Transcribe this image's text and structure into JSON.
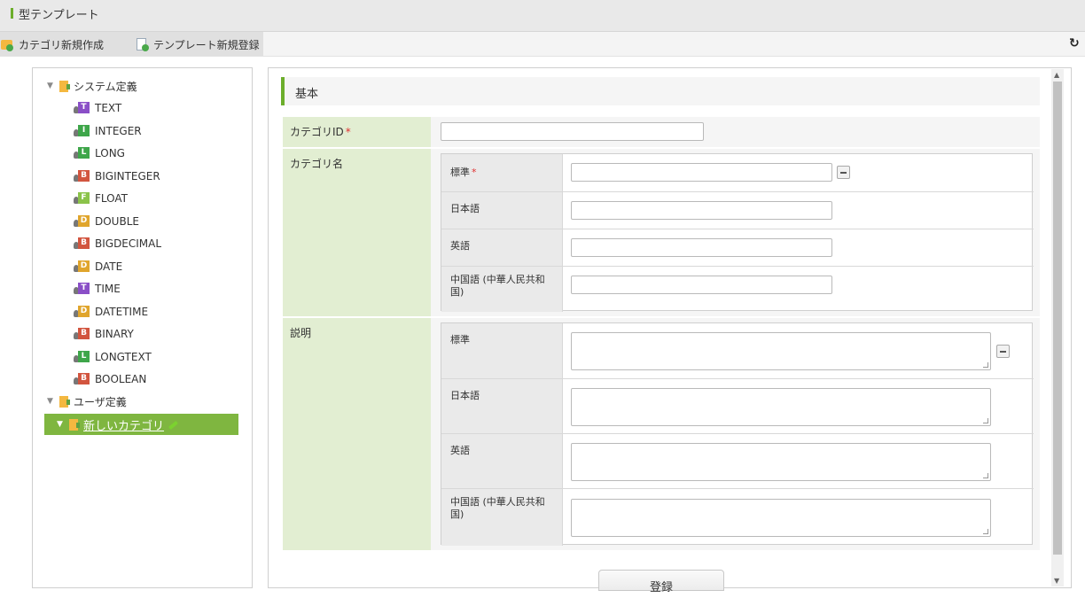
{
  "window": {
    "title": "型テンプレート"
  },
  "toolbar": {
    "new_category_label": "カテゴリ新規作成",
    "new_template_label": "テンプレート新規登録",
    "refresh_icon": "refresh-icon"
  },
  "tree": {
    "system_root": "システム定義",
    "types": [
      {
        "label": "TEXT",
        "badge": "T",
        "color": "#8a4fc7"
      },
      {
        "label": "INTEGER",
        "badge": "I",
        "color": "#3ea64a"
      },
      {
        "label": "LONG",
        "badge": "L",
        "color": "#3ea64a"
      },
      {
        "label": "BIGINTEGER",
        "badge": "B",
        "color": "#d2553f"
      },
      {
        "label": "FLOAT",
        "badge": "F",
        "color": "#8bc34a"
      },
      {
        "label": "DOUBLE",
        "badge": "D",
        "color": "#e0a52c"
      },
      {
        "label": "BIGDECIMAL",
        "badge": "B",
        "color": "#d2553f"
      },
      {
        "label": "DATE",
        "badge": "D",
        "color": "#e0a52c"
      },
      {
        "label": "TIME",
        "badge": "T",
        "color": "#8a4fc7"
      },
      {
        "label": "DATETIME",
        "badge": "D",
        "color": "#e0a52c"
      },
      {
        "label": "BINARY",
        "badge": "B",
        "color": "#d2553f"
      },
      {
        "label": "LONGTEXT",
        "badge": "L",
        "color": "#3ea64a"
      },
      {
        "label": "BOOLEAN",
        "badge": "B",
        "color": "#d2553f"
      }
    ],
    "user_root": "ユーザ定義",
    "selected_item": "新しいカテゴリ"
  },
  "form": {
    "section_title": "基本",
    "category_id_label": "カテゴリID",
    "category_id_value": "",
    "category_name_label": "カテゴリ名",
    "description_label": "説明",
    "lang_standard": "標準",
    "lang_japanese": "日本語",
    "lang_english": "英語",
    "lang_chinese": "中国語 (中華人民共和国)",
    "required_mark": "*",
    "register_button": "登録"
  }
}
